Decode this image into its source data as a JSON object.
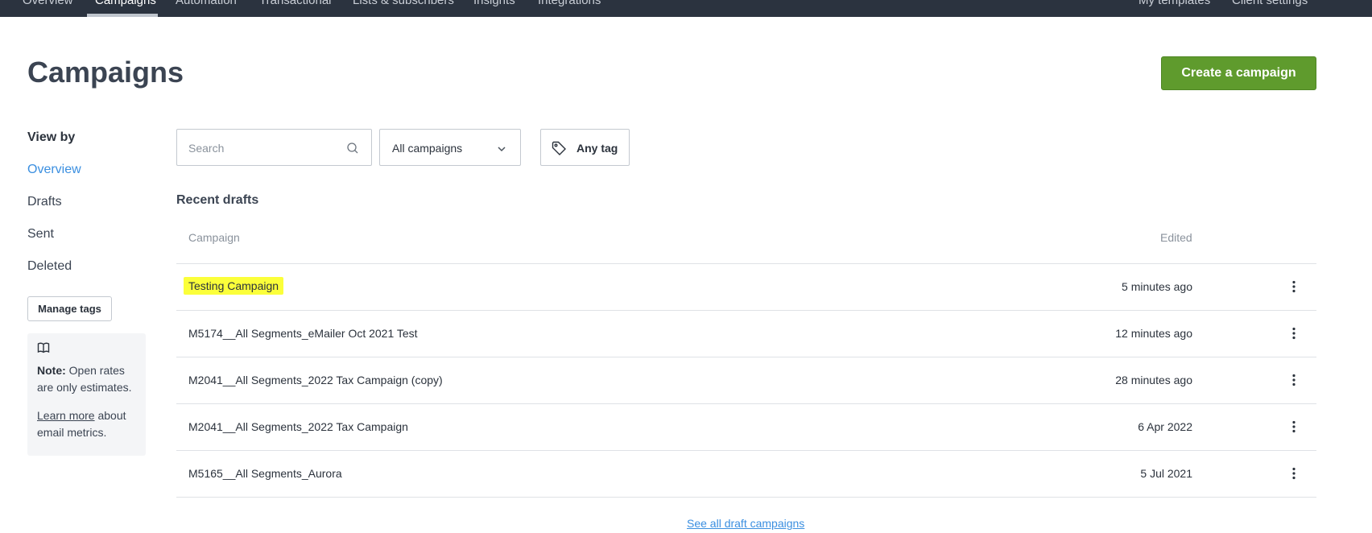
{
  "topnav": {
    "items": [
      "Overview",
      "Campaigns",
      "Automation",
      "Transactional",
      "Lists & subscribers",
      "Insights",
      "Integrations"
    ],
    "active": "Campaigns",
    "right_items": [
      "My templates",
      "Client settings"
    ]
  },
  "header": {
    "title": "Campaigns",
    "create_label": "Create a campaign"
  },
  "sidebar": {
    "view_by_label": "View by",
    "links": [
      "Overview",
      "Drafts",
      "Sent",
      "Deleted"
    ],
    "active_link": "Overview",
    "manage_tags_label": "Manage tags",
    "note": {
      "icon": "book-icon",
      "bold": "Note:",
      "text": " Open rates are only estimates.",
      "learn_more": "Learn more",
      "learn_more_rest": " about email metrics."
    }
  },
  "filters": {
    "search_placeholder": "Search",
    "campaign_select": "All campaigns",
    "tag_label": "Any tag"
  },
  "drafts": {
    "title": "Recent drafts",
    "col_campaign": "Campaign",
    "col_edited": "Edited",
    "rows": [
      {
        "name": "Testing Campaign",
        "edited": "5 minutes ago",
        "highlighted": true
      },
      {
        "name": "M5174__All Segments_eMailer Oct 2021 Test",
        "edited": "12 minutes ago"
      },
      {
        "name": "M2041__All Segments_2022 Tax Campaign (copy)",
        "edited": "28 minutes ago"
      },
      {
        "name": "M2041__All Segments_2022 Tax Campaign",
        "edited": "6 Apr 2022"
      },
      {
        "name": "M5165__All Segments_Aurora",
        "edited": "5 Jul 2021"
      }
    ],
    "see_all_label": "See all draft campaigns"
  },
  "colors": {
    "topnav_bg": "#2b333f",
    "primary_green": "#5f9b2d",
    "link_blue": "#3b8fe0",
    "highlight_yellow": "#fbff3a"
  }
}
